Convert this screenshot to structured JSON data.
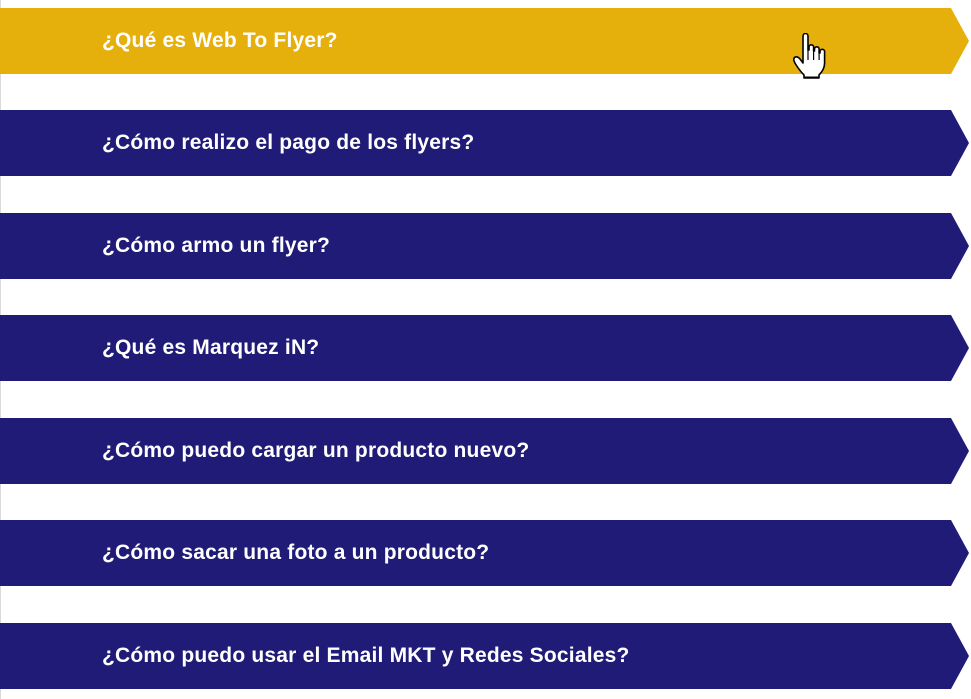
{
  "colors": {
    "active": "#E5B00B",
    "inactive": "#1F1B77",
    "text": "#FFFFFF"
  },
  "faq": {
    "items": [
      {
        "label": "¿Qué es Web To Flyer?",
        "state": "active"
      },
      {
        "label": "¿Cómo realizo el pago de los flyers?",
        "state": "inactive"
      },
      {
        "label": "¿Cómo armo un flyer?",
        "state": "inactive"
      },
      {
        "label": "¿Qué es Marquez iN?",
        "state": "inactive"
      },
      {
        "label": "¿Cómo puedo cargar un producto nuevo?",
        "state": "inactive"
      },
      {
        "label": "¿Cómo sacar una foto a un producto?",
        "state": "inactive"
      },
      {
        "label": "¿Cómo puedo usar el Email MKT y Redes Sociales?",
        "state": "inactive"
      }
    ]
  },
  "cursor": {
    "icon": "hand-pointer-icon"
  }
}
